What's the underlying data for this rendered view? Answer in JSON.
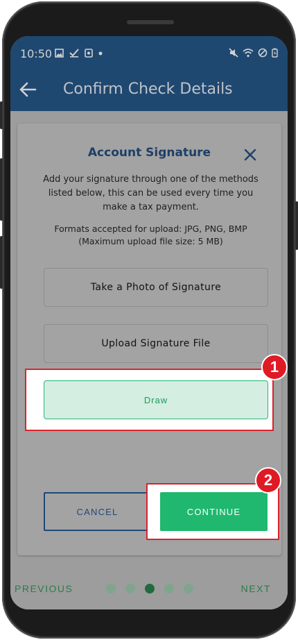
{
  "status_bar": {
    "time": "10:50"
  },
  "app_bar": {
    "title": "Confirm Check Details"
  },
  "modal": {
    "title": "Account Signature",
    "description": "Add your signature through one of the methods listed below, this can be used every time you make a tax payment.",
    "formats_line1": "Formats accepted for upload: JPG, PNG, BMP",
    "formats_line2": "(Maximum upload file size: 5 MB)",
    "options": [
      {
        "label": "Take a Photo of Signature"
      },
      {
        "label": "Upload Signature File"
      },
      {
        "label": "Draw"
      }
    ],
    "cancel_label": "CANCEL",
    "continue_label": "CONTINUE"
  },
  "callouts": [
    {
      "number": "1"
    },
    {
      "number": "2"
    }
  ],
  "bottom_nav": {
    "previous_label": "PREVIOUS",
    "next_label": "NEXT",
    "step_count": 5,
    "active_step": 3
  },
  "colors": {
    "header_blue": "#27588a",
    "accent_green": "#1fb86e",
    "callout_red": "#d6242e",
    "title_navy": "#1e3f66"
  }
}
